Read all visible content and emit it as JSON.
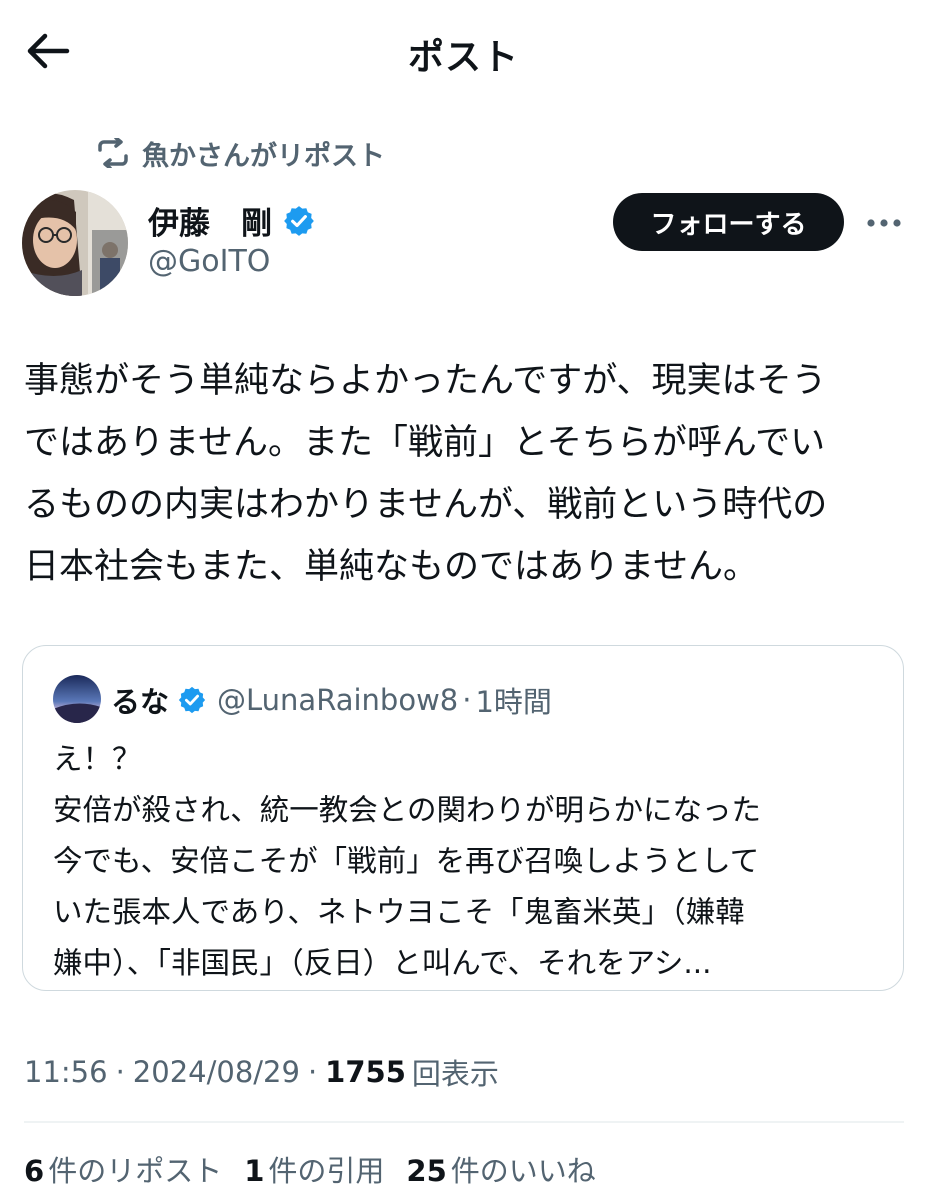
{
  "header": {
    "title": "ポスト",
    "back_icon": "arrow-left-icon"
  },
  "repost": {
    "label": "魚かさんがリポスト",
    "icon": "repost-icon"
  },
  "author": {
    "name": "伊藤　剛",
    "handle": "@GoITO",
    "verified": true
  },
  "follow_button": "フォローする",
  "more_icon": "more-horizontal-icon",
  "post": {
    "lines": [
      "事態がそう単純ならよかったんですが、現実はそう",
      "ではありません。また「戦前」とそちらが呼んでい",
      "るものの内実はわかりませんが、戦前という時代の",
      "日本社会もまた、単純なものではありません。"
    ]
  },
  "quote": {
    "name": "るな",
    "handle": "@LunaRainbow8",
    "dot": "·",
    "time": "1時間",
    "verified": true,
    "lines": [
      "え！？",
      "安倍が殺され、統一教会との関わりが明らかになった",
      "今でも、安倍こそが「戦前」を再び召喚しようとして",
      "いた張本人であり、ネトウヨこそ「鬼畜米英」（嫌韓",
      "嫌中）、「非国民」（反日）と叫んで、それをアシ..."
    ]
  },
  "meta": {
    "time": "11:56",
    "sep1": "·",
    "date": "2024/08/29",
    "sep2": "·",
    "views_count": "1755",
    "views_label": "回表示"
  },
  "stats": {
    "reposts": {
      "count": "6",
      "label": "件のリポスト"
    },
    "quotes": {
      "count": "1",
      "label": "件の引用"
    },
    "likes": {
      "count": "25",
      "label": "件のいいね"
    }
  },
  "colors": {
    "text": "#0f1419",
    "secondary": "#536471",
    "verified": "#1d9bf0",
    "border": "#cfd9de",
    "button_bg": "#0f1419"
  }
}
